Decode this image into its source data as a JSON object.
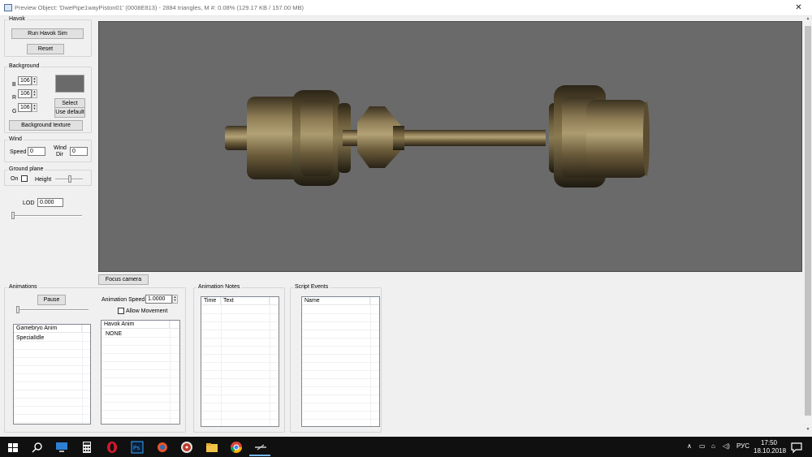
{
  "window": {
    "title": "Preview Object: 'DwePipe1wayPiston01' (0008E813) - 2884 triangles, M #: 0.08% (129.17 KB / 157.00 MB)",
    "close_glyph": "✕"
  },
  "havok": {
    "legend": "Havok",
    "run_label": "Run Havok Sim",
    "reset_label": "Reset"
  },
  "background": {
    "legend": "Background",
    "b_label": "B",
    "b_value": "106",
    "r_label": "R",
    "r_value": "106",
    "g_label": "G",
    "g_value": "106",
    "swatch_color": "#6a6a6a",
    "select_label": "Select",
    "use_default_label": "Use default",
    "texture_label": "Background texture"
  },
  "wind": {
    "legend": "Wind",
    "speed_label": "Speed",
    "speed_value": "0",
    "dir_label_1": "Wind",
    "dir_label_2": "Dir",
    "dir_value": "0"
  },
  "ground_plane": {
    "legend": "Ground plane",
    "on_label": "On",
    "on_checked": false,
    "height_label": "Height"
  },
  "lod": {
    "label": "LOD",
    "value": "0.000"
  },
  "viewport": {
    "background_color": "#6a6a6a"
  },
  "focus_camera_label": "Focus camera",
  "animations": {
    "legend": "Animations",
    "pause_label": "Pause",
    "speed_label": "Animation Speed",
    "speed_value": "1.0000",
    "allow_movement_label": "Allow Movement",
    "allow_movement_checked": false,
    "gamebryo_header": "Gamebryo Anim",
    "gamebryo_items": [
      "SpecialIdle"
    ],
    "havok_header": "Havok Anim",
    "havok_items": [
      "NONE"
    ]
  },
  "animation_notes": {
    "legend": "Animation Notes",
    "col_time": "Time",
    "col_text": "Text"
  },
  "script_events": {
    "legend": "Script Events",
    "col_name": "Name"
  },
  "taskbar": {
    "language": "РУС",
    "time": "17:50",
    "date": "18.10.2018"
  }
}
